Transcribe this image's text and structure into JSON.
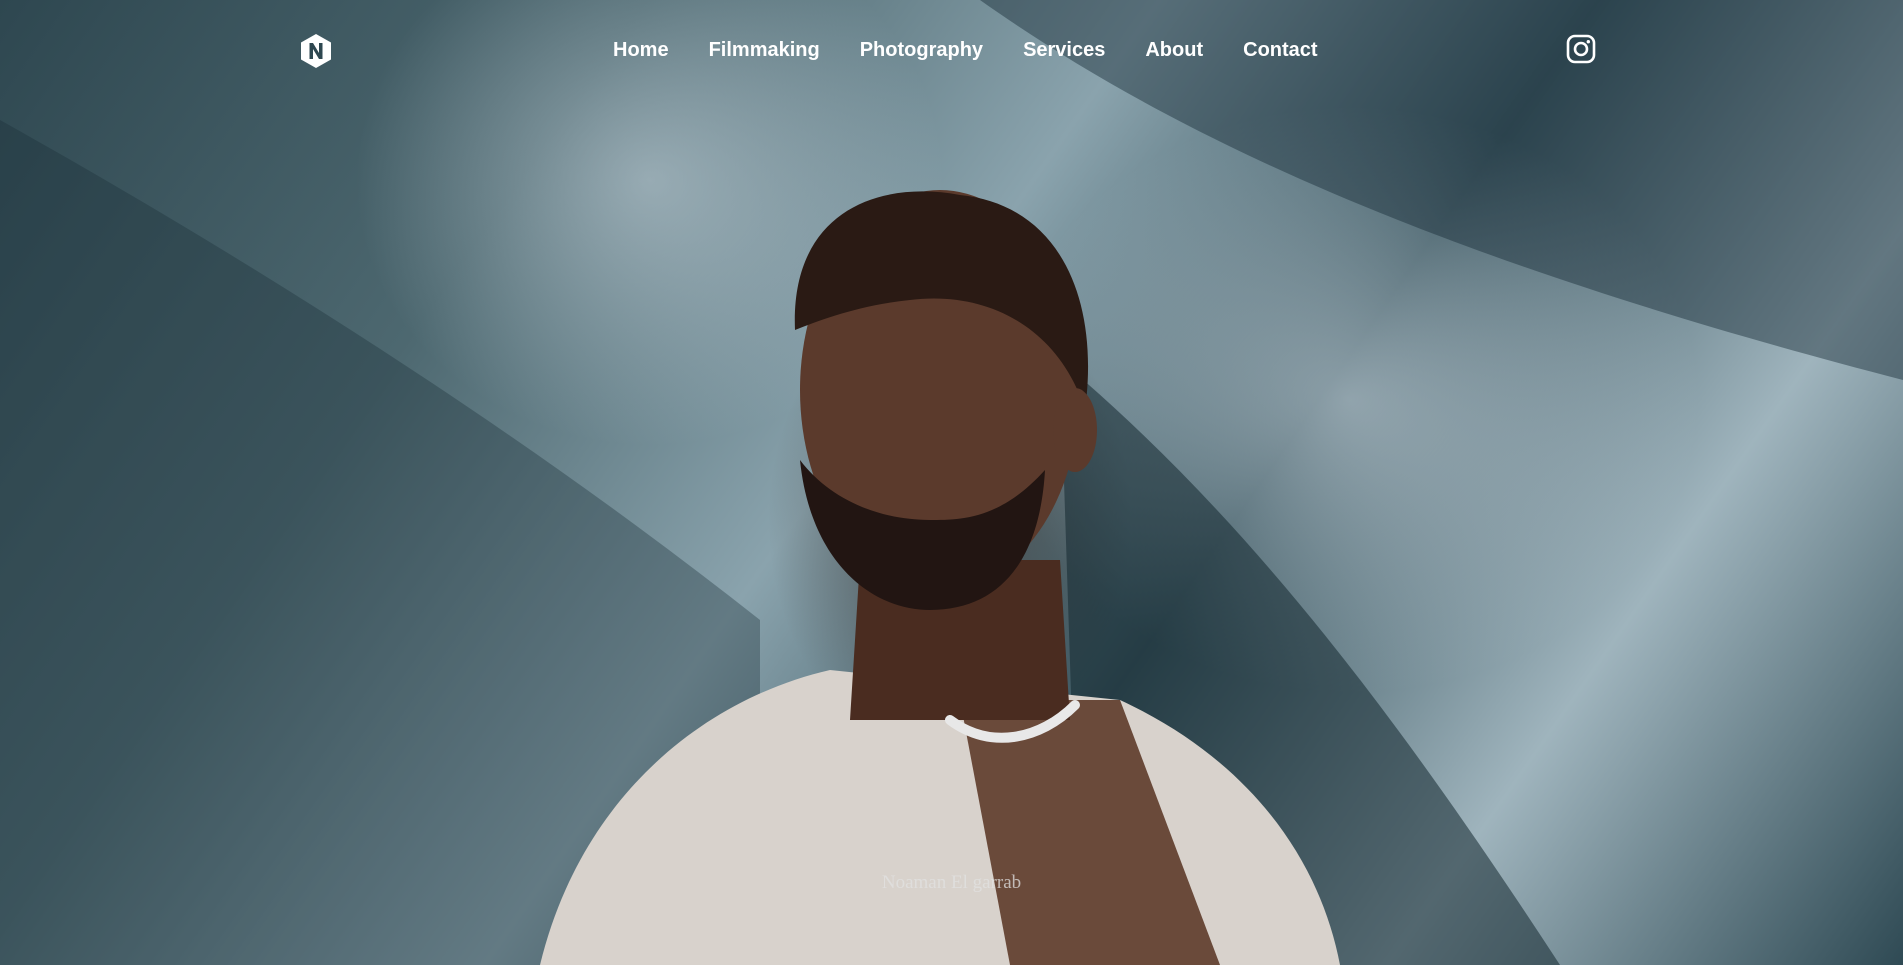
{
  "site": {
    "logo_icon": "hexagon-n-logo-icon",
    "brand_color": "#ffffff"
  },
  "nav": {
    "items": [
      {
        "label": "Home"
      },
      {
        "label": "Filmmaking"
      },
      {
        "label": "Photography"
      },
      {
        "label": "Services"
      },
      {
        "label": "About"
      },
      {
        "label": "Contact"
      }
    ],
    "social_icon": "instagram-icon"
  },
  "hero": {
    "caption": "Noaman El garrab",
    "image_subject": "portrait-photo"
  }
}
